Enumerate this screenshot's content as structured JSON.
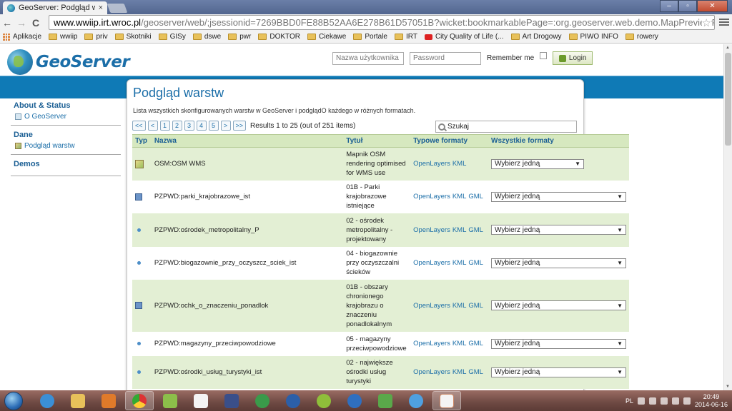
{
  "browser": {
    "tab_title": "GeoServer: Podgląd warstw",
    "tab_close": "×",
    "url_host": "www.wwiip.irt.wroc.pl",
    "url_path": "/geoserver/web/;jsessionid=7269BBD0FE88B52AA6E278B61D57051B?wicket:bookmarkablePage=:org.geoserver.web.demo.MapPreviewPage",
    "win_min": "–",
    "win_max": "▫",
    "win_close": "✕",
    "back": "←",
    "forward": "→",
    "reload": "C",
    "star": "☆"
  },
  "bookmarks": [
    "Aplikacje",
    "wwiip",
    "priv",
    "Skotniki",
    "GISy",
    "dswe",
    "pwr",
    "DOKTOR",
    "Ciekawe",
    "Portale",
    "IRT",
    "City Quality of Life (...",
    "Art Drogowy",
    "PIWO INFO",
    "rowery"
  ],
  "header": {
    "logo_text": "GeoServer",
    "username_placeholder": "Nazwa użytkownika",
    "password_placeholder": "Password",
    "remember_me": "Remember me",
    "login_label": "Login"
  },
  "sidebar": {
    "sections": [
      {
        "title": "About & Status",
        "items": [
          "O GeoServer"
        ]
      },
      {
        "title": "Dane",
        "items": [
          "Podgląd warstw"
        ]
      },
      {
        "title": "Demos",
        "items": []
      }
    ]
  },
  "main": {
    "title": "Podgląd warstw",
    "description": "Lista wszystkich skonfigurowanych warstw w GeoServer i podglądO każdego w różnych formatach.",
    "pager": {
      "buttons": [
        "<<",
        "<",
        "1",
        "2",
        "3",
        "4",
        "5",
        ">",
        ">>"
      ],
      "info": "Results 1 to 25 (out of 251 items)"
    },
    "search_placeholder": "Szukaj",
    "columns": [
      "Typ",
      "Nazwa",
      "Tytuł",
      "Typowe formaty",
      "Wszystkie formaty"
    ],
    "select_label": "Wybierz jedną",
    "rows": [
      {
        "type": "raster",
        "name": "OSM:OSM WMS",
        "title": "Mapnik OSM rendering optimised for WMS use",
        "formats": [
          "OpenLayers",
          "KML"
        ]
      },
      {
        "type": "polygon",
        "name": "PZPWD:parki_krajobrazowe_ist",
        "title": "01B - Parki krajobrazowe istniejące",
        "formats": [
          "OpenLayers",
          "KML",
          "GML"
        ]
      },
      {
        "type": "point",
        "name": "PZPWD:ośrodek_metropolitalny_P",
        "title": "02 - ośrodek metropolitalny - projektowany",
        "formats": [
          "OpenLayers",
          "KML",
          "GML"
        ]
      },
      {
        "type": "point",
        "name": "PZPWD:biogazownie_przy_oczyszcz_sciek_ist",
        "title": "04 - biogazownie przy oczyszczalni ścieków",
        "formats": [
          "OpenLayers",
          "KML",
          "GML"
        ]
      },
      {
        "type": "polygon",
        "name": "PZPWD:ochk_o_znaczeniu_ponadlok",
        "title": "01B - obszary chronionego krajobrazu o znaczeniu ponadlokalnym",
        "formats": [
          "OpenLayers",
          "KML",
          "GML"
        ]
      },
      {
        "type": "point",
        "name": "PZPWD:magazyny_przeciwpowodziowe",
        "title": "05 - magazyny przeciwpowodziowe",
        "formats": [
          "OpenLayers",
          "KML",
          "GML"
        ]
      },
      {
        "type": "point",
        "name": "PZPWD:ośrodki_usług_turystyki_ist",
        "title": "02 - największe ośrodki usług turystyki",
        "formats": [
          "OpenLayers",
          "KML",
          "GML"
        ]
      }
    ]
  },
  "taskbar": {
    "lang": "PL",
    "time": "20:49",
    "date": "2014-06-16"
  }
}
